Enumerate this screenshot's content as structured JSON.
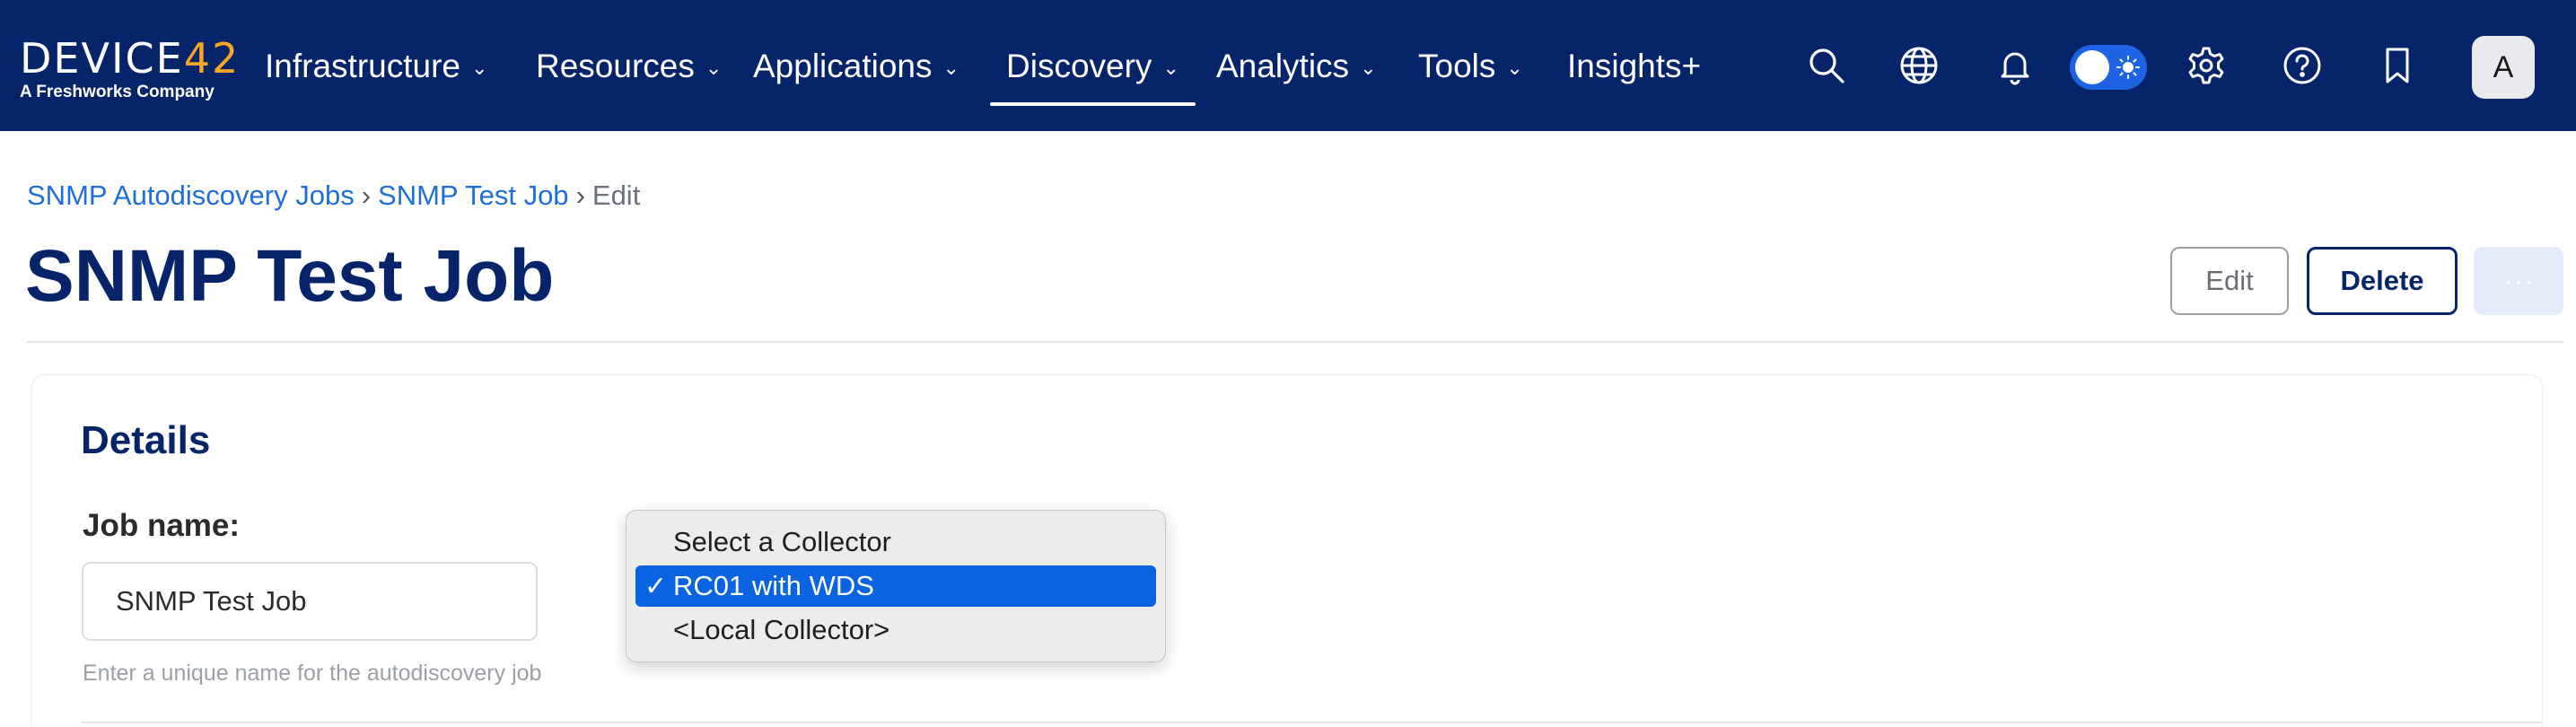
{
  "logo": {
    "main_prefix": "DEVICE",
    "main_number": "42",
    "sub": "A Freshworks Company"
  },
  "nav": {
    "items": [
      {
        "label": "Infrastructure",
        "has_chevron": true
      },
      {
        "label": "Resources",
        "has_chevron": true
      },
      {
        "label": "Applications",
        "has_chevron": true
      },
      {
        "label": "Discovery",
        "has_chevron": true,
        "active": true
      },
      {
        "label": "Analytics",
        "has_chevron": true
      },
      {
        "label": "Tools",
        "has_chevron": true
      },
      {
        "label": "Insights+",
        "has_chevron": false
      }
    ],
    "chevron": "⌄",
    "icons": [
      "search-icon",
      "globe-icon",
      "bell-icon",
      "theme-toggle",
      "gear-icon",
      "help-icon",
      "bookmark-icon"
    ],
    "avatar_initial": "A"
  },
  "breadcrumb": {
    "items": [
      "SNMP Autodiscovery Jobs",
      "SNMP Test Job",
      "Edit"
    ],
    "separator": "›"
  },
  "page": {
    "title": "SNMP Test Job",
    "buttons": {
      "edit": "Edit",
      "delete": "Delete",
      "more": "···"
    }
  },
  "details": {
    "title": "Details",
    "job_name_label": "Job name:",
    "job_name_value": "SNMP Test Job",
    "job_name_helper": "Enter a unique name for the autodiscovery job"
  },
  "collector_dropdown": {
    "options": [
      "Select a Collector",
      "RC01 with WDS",
      "<Local Collector>"
    ],
    "selected_index": 1,
    "check_mark": "✓"
  },
  "colors": {
    "nav_bg": "#05246a",
    "accent_blue": "#1e6fd9",
    "logo_accent": "#f5a623",
    "selected_option": "#0a63e0",
    "title_navy": "#05246a"
  }
}
